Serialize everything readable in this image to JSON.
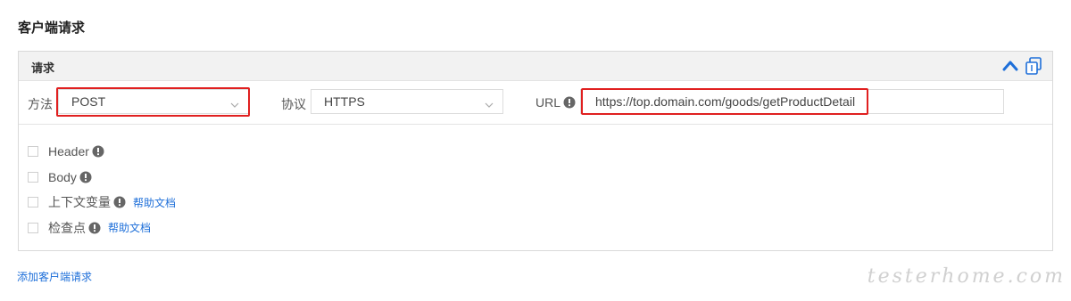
{
  "section": {
    "title": "客户端请求"
  },
  "panel": {
    "title": "请求",
    "method": {
      "label": "方法",
      "value": "POST"
    },
    "protocol": {
      "label": "协议",
      "value": "HTTPS"
    },
    "url": {
      "label": "URL",
      "value": "https://top.domain.com/goods/getProductDetail"
    },
    "options": [
      {
        "label": "Header",
        "help": ""
      },
      {
        "label": "Body",
        "help": ""
      },
      {
        "label": "上下文变量",
        "help": "帮助文档"
      },
      {
        "label": "检查点",
        "help": "帮助文档"
      }
    ]
  },
  "footer": {
    "add_label": "添加客户端请求"
  },
  "watermark": "testerhome.com",
  "colors": {
    "accent": "#1e6fd9",
    "highlight": "#e02020",
    "info_icon": "#666666",
    "header_bg": "#f2f2f2"
  }
}
